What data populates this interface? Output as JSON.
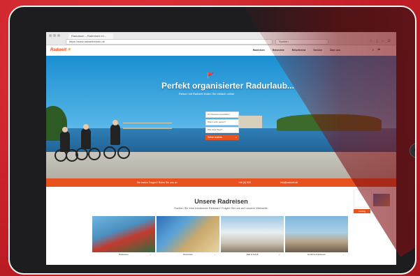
{
  "browser": {
    "tab_title": "Radurlaub – Radreisen mi...",
    "url": "https://www.radweltreisen.de",
    "search_placeholder": "Suchen"
  },
  "site": {
    "logo": "Radweit",
    "nav": [
      "Radreisen",
      "Reiseziele",
      "Reisethema",
      "Service",
      "Über uns"
    ]
  },
  "hero": {
    "title": "Perfekt organisierter Radurlaub...",
    "subtitle": "Reisen mit Radweit finden Sie einfach online",
    "form": {
      "field_1": "Ihr Reiseziel auswählen",
      "field_2": "Wann soll's gehen?",
      "field_3": "Wie viele Tage?",
      "button": "Reise suchen"
    }
  },
  "info_bar": {
    "left": "Sie haben Fragen? Rufen Sie uns an",
    "phone": "+49 (0) 800",
    "email": "info@radweit.de"
  },
  "section": {
    "title": "Unsere Radreisen",
    "subtitle": "Suchen Sie eine bestimmte Reiseart? Folgen Sie uns auf unserer Webseite."
  },
  "side_promo": {
    "button": "Katalog"
  },
  "tiles": [
    {
      "label": "Radreisen"
    },
    {
      "label": "Reiseziele"
    },
    {
      "label": "Rad & Schiff"
    },
    {
      "label": "Geführte Radreisen"
    }
  ],
  "colors": {
    "brand_orange": "#e8521f",
    "background_red": "#d3272f",
    "sky_blue": "#1b8fd2"
  }
}
